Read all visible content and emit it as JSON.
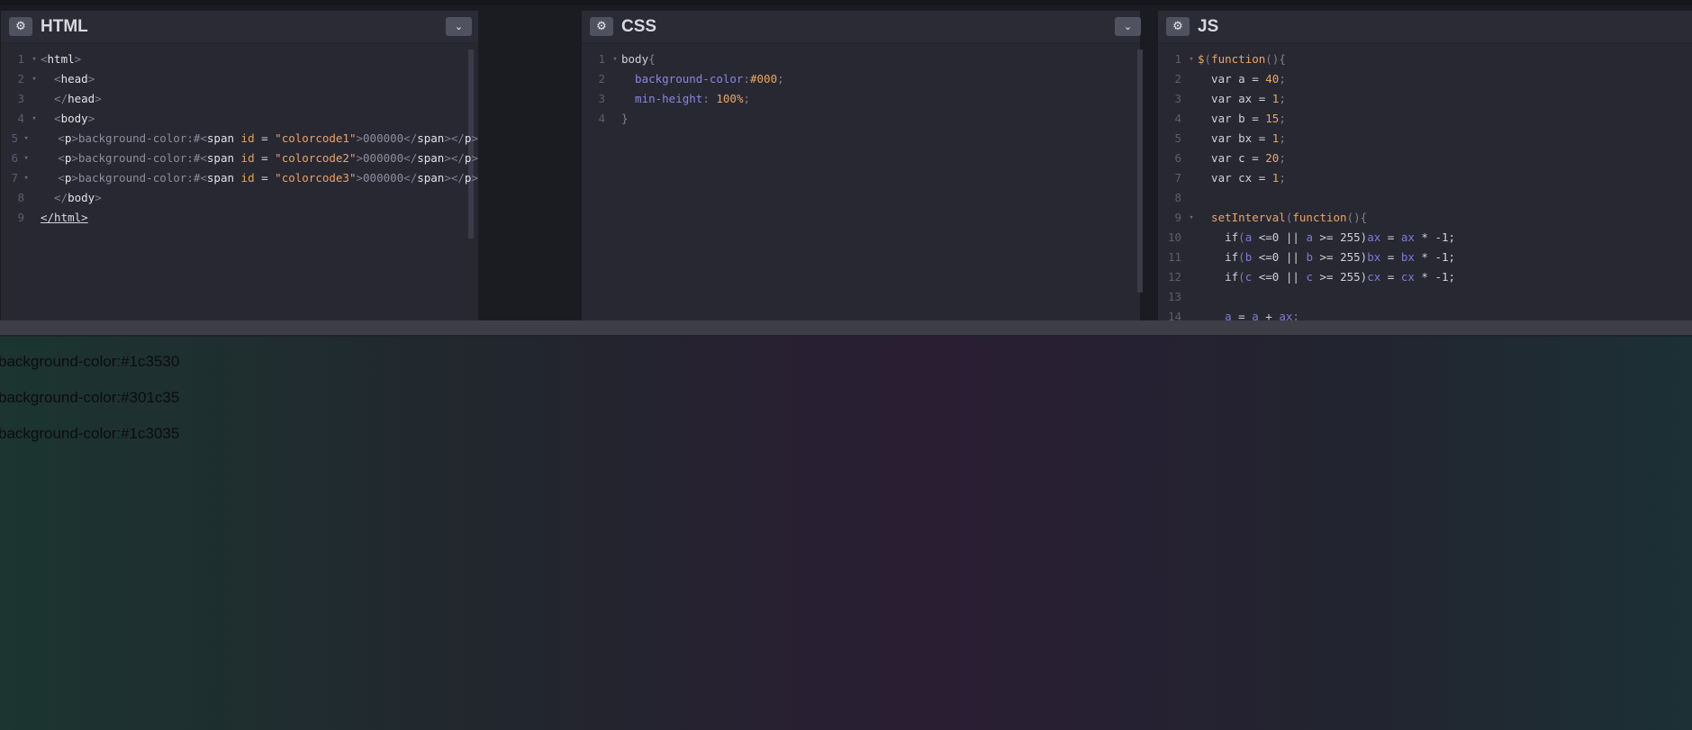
{
  "panels": {
    "html": {
      "title": "HTML",
      "gear": "⚙",
      "dropdown": "⌄"
    },
    "css": {
      "title": "CSS",
      "gear": "⚙",
      "dropdown": "⌄"
    },
    "js": {
      "title": "JS",
      "gear": "⚙"
    }
  },
  "html_code": [
    {
      "n": "1",
      "fold": "▾"
    },
    {
      "n": "2",
      "fold": "▾"
    },
    {
      "n": "3",
      "fold": ""
    },
    {
      "n": "4",
      "fold": "▾"
    },
    {
      "n": "5",
      "fold": "▾"
    },
    {
      "n": "6",
      "fold": "▾"
    },
    {
      "n": "7",
      "fold": "▾"
    },
    {
      "n": "8",
      "fold": ""
    },
    {
      "n": "9",
      "fold": ""
    }
  ],
  "html_text": {
    "l1_a": "<",
    "l1_b": "html",
    "l1_c": ">",
    "l2_a": "  <",
    "l2_b": "head",
    "l2_c": ">",
    "l3_a": "  </",
    "l3_b": "head",
    "l3_c": ">",
    "l4_a": "  <",
    "l4_b": "body",
    "l4_c": ">",
    "p_open_a": "    <",
    "p_tag": "p",
    "p_open_c": ">",
    "p_text": "background-color:#",
    "span_open": "<",
    "span_tag": "span",
    "span_id": " id",
    "eq": " = ",
    "id1": "\"colorcode1\"",
    "id2": "\"colorcode2\"",
    "id3": "\"colorcode3\"",
    "gt": ">",
    "zeros": "000000",
    "span_close_a": "</",
    "span_close_b": "span",
    "span_close_c": "></",
    "p_close_b": "p",
    "p_close_c": ">",
    "l8_a": "  </",
    "l8_b": "body",
    "l8_c": ">",
    "l9": "</html>"
  },
  "css_code": [
    {
      "n": "1",
      "fold": "▾"
    },
    {
      "n": "2",
      "fold": ""
    },
    {
      "n": "3",
      "fold": ""
    },
    {
      "n": "4",
      "fold": ""
    }
  ],
  "css_text": {
    "sel": "body",
    "brace_open": "{",
    "prop1": "  background-color",
    "colon": ":",
    "val1": "#000",
    "semi": ";",
    "prop2": "  min-height",
    "colon2": ": ",
    "val2": "100%",
    "brace_close": "}"
  },
  "js_code": [
    {
      "n": "1",
      "fold": "▾"
    },
    {
      "n": "2",
      "fold": ""
    },
    {
      "n": "3",
      "fold": ""
    },
    {
      "n": "4",
      "fold": ""
    },
    {
      "n": "5",
      "fold": ""
    },
    {
      "n": "6",
      "fold": ""
    },
    {
      "n": "7",
      "fold": ""
    },
    {
      "n": "8",
      "fold": ""
    },
    {
      "n": "9",
      "fold": "▾"
    },
    {
      "n": "10",
      "fold": ""
    },
    {
      "n": "11",
      "fold": ""
    },
    {
      "n": "12",
      "fold": ""
    },
    {
      "n": "13",
      "fold": ""
    },
    {
      "n": "14",
      "fold": ""
    }
  ],
  "js_text": {
    "l1_a": "$",
    "l1_b": "(",
    "l1_c": "function",
    "l1_d": "(){",
    "var": "  var ",
    "a": "a",
    "ax": "ax",
    "b": "b",
    "bx": "bx",
    "c": "c",
    "cx": "cx",
    "eq": " = ",
    "semi": ";",
    "v40": "40",
    "v1": "1",
    "v15": "15",
    "v20": "20",
    "l9_a": "  setInterval",
    "l9_b": "(",
    "l9_c": "function",
    "l9_d": "(){",
    "if": "    if",
    "paren": "(",
    "lte": " <=0 || ",
    "gte": " >= 255)",
    "mul": " * -1;",
    "l14_a": "    a",
    "l14_b": " = ",
    "l14_c": "a",
    "l14_d": " + ",
    "l14_e": "ax",
    "l14_f": ";"
  },
  "preview": {
    "line1": "background-color:#1c3530",
    "line2": "background-color:#301c35",
    "line3": "background-color:#1c3035"
  }
}
